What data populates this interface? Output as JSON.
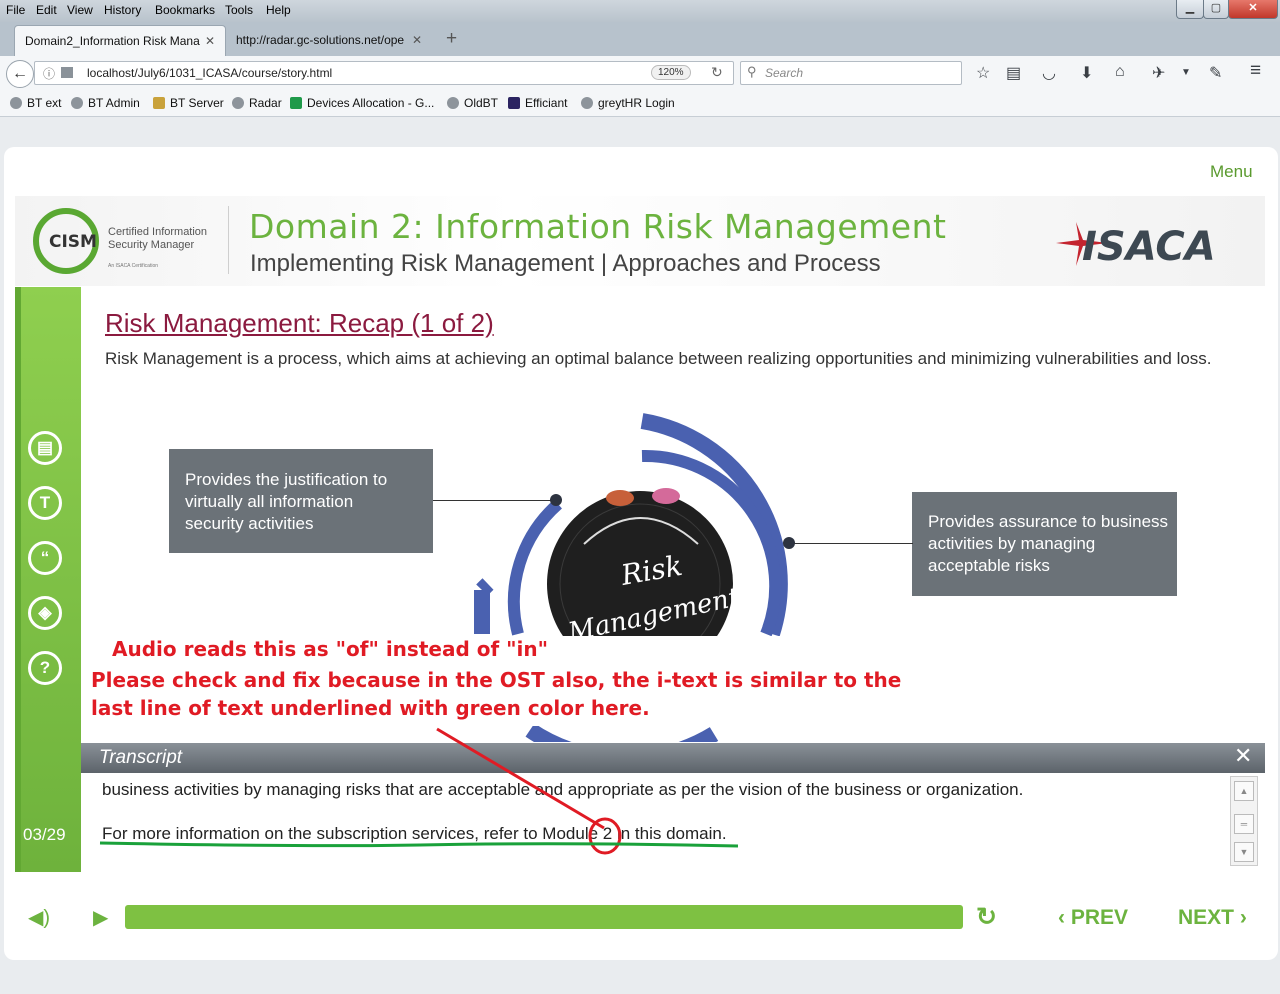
{
  "browser": {
    "menu_items": [
      "File",
      "Edit",
      "View",
      "History",
      "Bookmarks",
      "Tools",
      "Help"
    ],
    "tabs": [
      {
        "label": "Domain2_Information Risk Mana"
      },
      {
        "label": "http://radar.gc-solutions.net/ope"
      }
    ],
    "new_tab": "+",
    "url": "localhost/July6/1031_ICASA/course/story.html",
    "zoom": "120%",
    "search_placeholder": "Search",
    "bookmarks": [
      "BT ext",
      "BT Admin",
      "BT Server",
      "Radar",
      "Devices Allocation - G...",
      "OldBT",
      "Efficiant",
      "greytHR Login"
    ]
  },
  "player": {
    "menu_label": "Menu",
    "header": {
      "title": "Domain 2: Information Risk Management",
      "subtitle": "Implementing Risk Management | Approaches and Process",
      "cism_mark": "CISM",
      "cism_text_1": "Certified Information",
      "cism_text_2": "Security Manager",
      "cism_text_3": "An ISACA Certification",
      "isaca_logo": "ISACA"
    },
    "slide": {
      "title": "Risk Management: Recap (1 of 2)",
      "intro": "Risk Management is a process, which aims at achieving an optimal balance between realizing opportunities and minimizing vulnerabilities and loss.",
      "left_callout": [
        "Provides the justification to",
        "virtually all information",
        "security activities"
      ],
      "right_callout": [
        "Provides assurance to business",
        "activities by managing",
        "acceptable risks"
      ],
      "center_text_1": "Risk",
      "center_text_2": "Management"
    },
    "sidebar": {
      "icons": [
        "notes-icon",
        "transcript-icon",
        "quote-icon",
        "resources-icon",
        "help-icon"
      ],
      "page_count": "03/29"
    },
    "transcript": {
      "title": "Transcript",
      "line1": "business activities by managing risks that are acceptable and appropriate as per the vision of the business or organization.",
      "line2": "For more information on the subscription services, refer to Module 2 in this domain."
    },
    "controls": {
      "prev": "PREV",
      "next": "NEXT"
    }
  },
  "annotation": {
    "line1": "Audio reads this as \"of\" instead of \"in\"",
    "line2": "Please check and fix because in the OST also, the i-text is similar to the",
    "line3": "last line of text underlined with green color here.",
    "color": "#e01b24",
    "underline_color": "#1aa13a"
  }
}
